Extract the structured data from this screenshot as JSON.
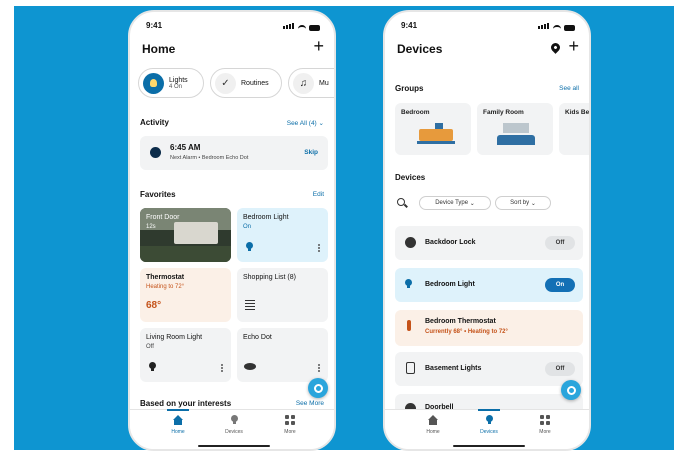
{
  "colors": {
    "background": "#0e95d1",
    "accent": "#0b6ea8",
    "on_toggle": "#1370b5",
    "alert_orange": "#c5531a",
    "light_card": "#def2fb",
    "warm_card": "#fbf0e7"
  },
  "home": {
    "status_time": "9:41",
    "title": "Home",
    "chips": [
      {
        "label": "Lights",
        "sub": "4 On",
        "icon": "bulb-icon"
      },
      {
        "label": "Routines",
        "sub": "",
        "icon": "check-circle-icon"
      },
      {
        "label": "Mu",
        "sub": "",
        "icon": "music-note-icon"
      }
    ],
    "activity": {
      "heading": "Activity",
      "see_all": "See All (4)",
      "time": "6:45 AM",
      "detail": "Next Alarm • Bedroom Echo Dot",
      "action": "Skip"
    },
    "favorites": {
      "heading": "Favorites",
      "edit": "Edit",
      "tiles": [
        {
          "name": "Front Door",
          "sub": "12s"
        },
        {
          "name": "Bedroom Light",
          "sub": "On"
        },
        {
          "name": "Thermostat",
          "sub": "Heating to 72°",
          "value": "68°"
        },
        {
          "name": "Shopping List (8)",
          "sub": ""
        },
        {
          "name": "Living Room Light",
          "sub": "Off"
        },
        {
          "name": "Echo Dot",
          "sub": ""
        }
      ]
    },
    "interests": {
      "heading": "Based on your interests",
      "see_more": "See More"
    }
  },
  "devices": {
    "status_time": "9:41",
    "title": "Devices",
    "groups_heading": "Groups",
    "groups_see_all": "See all",
    "groups": [
      {
        "name": "Bedroom"
      },
      {
        "name": "Family Room"
      },
      {
        "name": "Kids Be"
      }
    ],
    "devices_heading": "Devices",
    "filters": {
      "device_type": "Device Type",
      "sort_by": "Sort by"
    },
    "list": [
      {
        "name": "Backdoor Lock",
        "state": "Off",
        "icon": "lock-icon"
      },
      {
        "name": "Bedroom Light",
        "state": "On",
        "icon": "bulb-icon"
      },
      {
        "name": "Bedroom Thermostat",
        "sub": "Currently 68° • Heating to 72°",
        "icon": "thermometer-icon"
      },
      {
        "name": "Basement Lights",
        "state": "Off",
        "icon": "plug-icon"
      },
      {
        "name": "Doorbell",
        "state": "",
        "icon": "doorbell-icon"
      }
    ]
  },
  "tabs": [
    {
      "label": "Home"
    },
    {
      "label": "Devices"
    },
    {
      "label": "More"
    }
  ]
}
